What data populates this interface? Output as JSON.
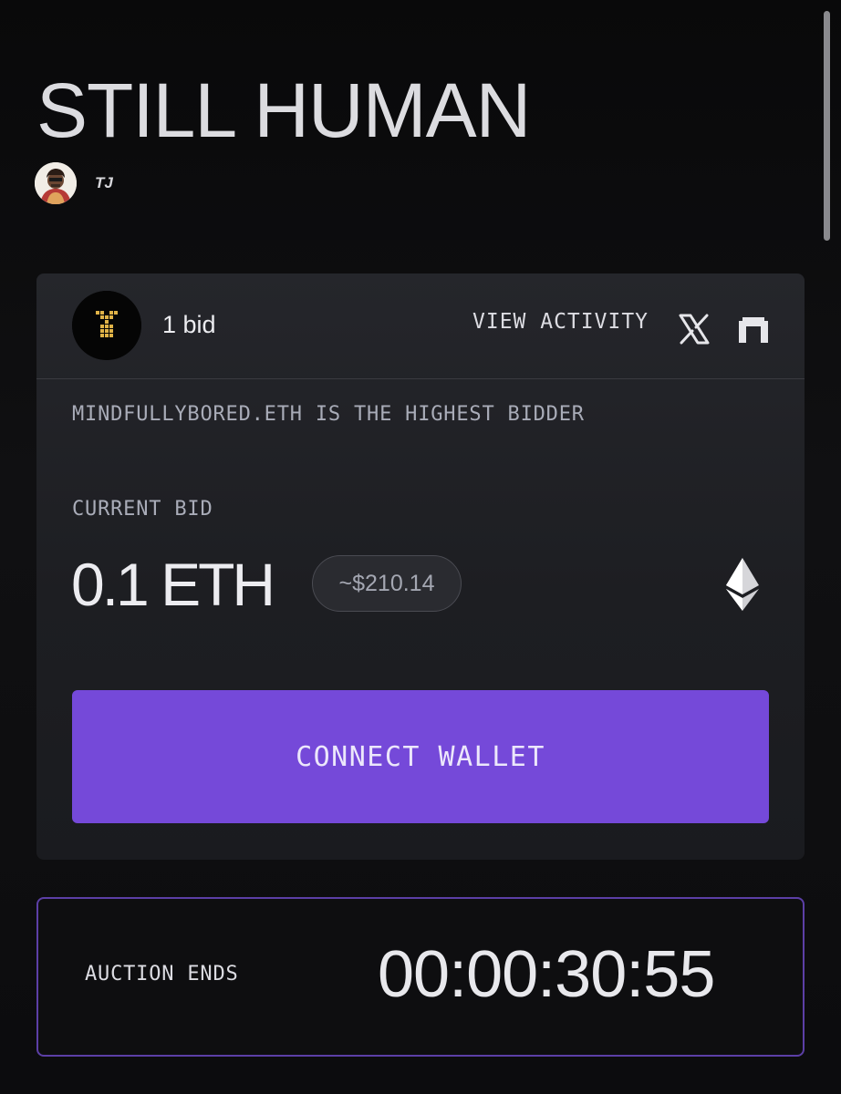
{
  "title": "STILL HUMAN",
  "author": {
    "name": "TJ"
  },
  "bid_card": {
    "bid_count": "1 bid",
    "view_activity": "VIEW ACTIVITY",
    "highest_bidder": "MINDFULLYBORED.ETH IS THE HIGHEST BIDDER",
    "current_bid_label": "CURRENT BID",
    "current_bid": "0.1 ETH",
    "usd_value": "~$210.14",
    "connect_wallet": "CONNECT WALLET",
    "icons": [
      "x-icon",
      "gate-icon",
      "ethereum-icon"
    ]
  },
  "auction": {
    "label": "AUCTION ENDS",
    "countdown": "00:00:30:55"
  },
  "colors": {
    "accent": "#7549d9",
    "border_accent": "#5c3fa6",
    "background": "#0c0c0e",
    "card": "#1f2024"
  }
}
